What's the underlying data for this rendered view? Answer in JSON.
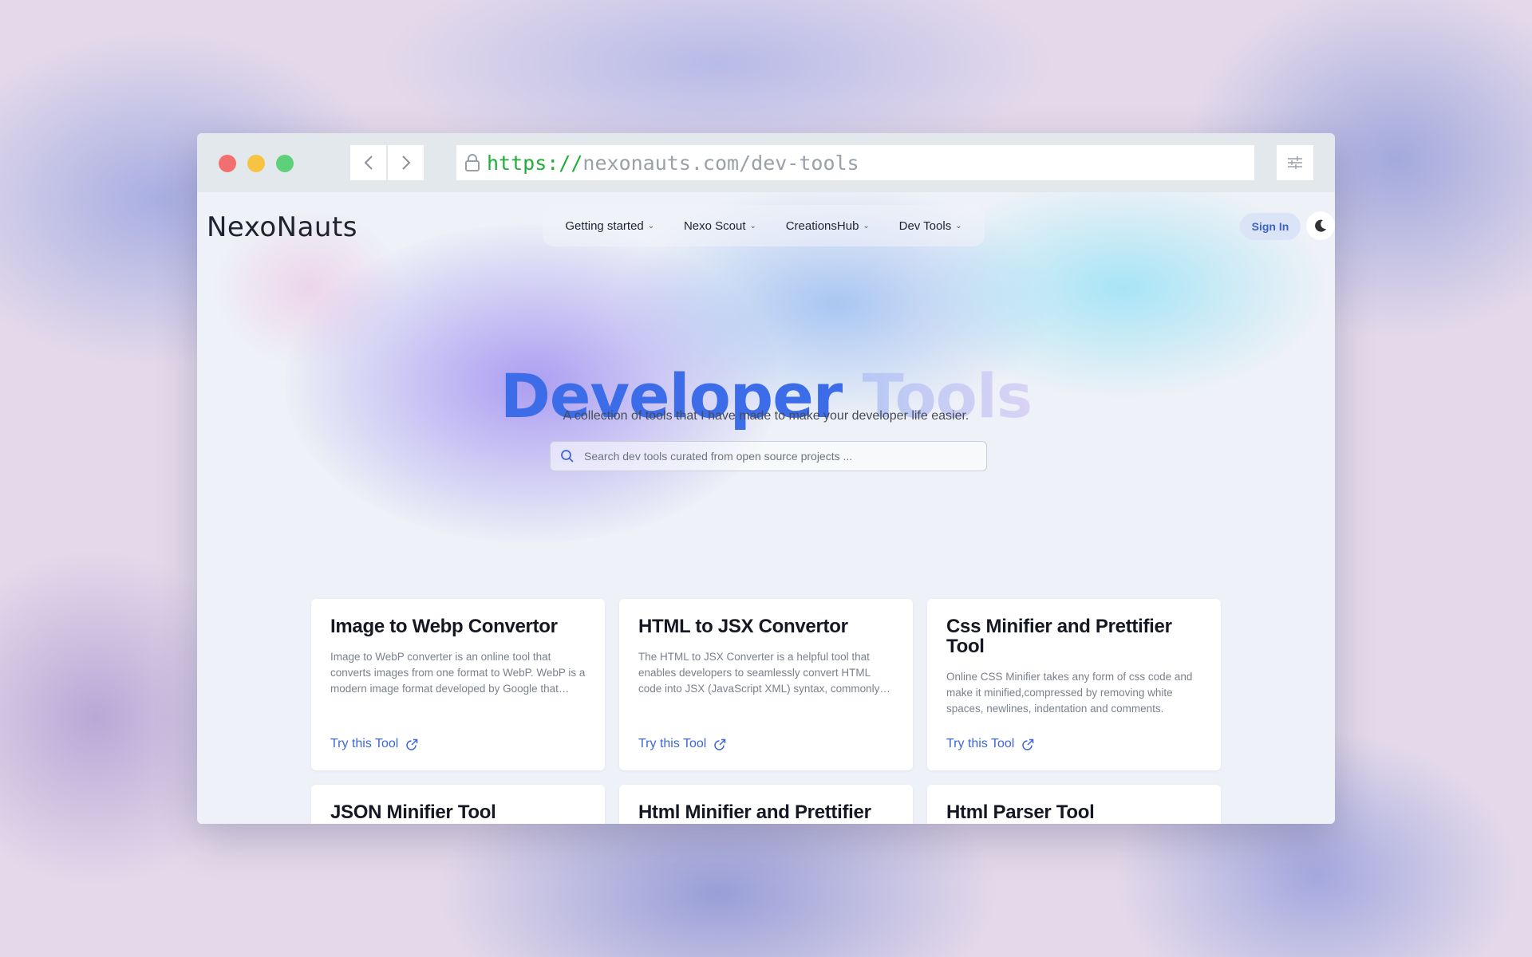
{
  "browser": {
    "url_protocol": "https://",
    "url_path": "nexonauts.com/dev-tools"
  },
  "site": {
    "logo": "NexoNauts",
    "nav": [
      {
        "label": "Getting started"
      },
      {
        "label": "Nexo Scout"
      },
      {
        "label": "CreationsHub"
      },
      {
        "label": "Dev Tools"
      }
    ],
    "signin_label": "Sign In"
  },
  "hero": {
    "title_word1": "Developer",
    "title_word2": "Tools",
    "subtitle": "A collection of tools that I have made to make your developer life easier.",
    "search_placeholder": "Search dev tools curated from open source projects ..."
  },
  "tools": [
    {
      "title": "Image to Webp Convertor",
      "description": "Image to WebP converter is an online tool that converts images from one format to WebP. WebP is a modern image format developed by Google that provides superior lossless and lossy compression.",
      "cta": "Try this Tool"
    },
    {
      "title": "HTML to JSX Convertor",
      "description": "The HTML to JSX Converter is a helpful tool that enables developers to seamlessly convert HTML code into JSX (JavaScript XML) syntax, commonly used in React applications.",
      "cta": "Try this Tool"
    },
    {
      "title": "Css Minifier and Prettifier Tool",
      "description": "Online CSS Minifier takes any form of css code and make it minified,compressed by removing white spaces, newlines, indentation and comments.",
      "cta": "Try this Tool"
    },
    {
      "title": "JSON Minifier Tool"
    },
    {
      "title": "Html Minifier and Prettifier"
    },
    {
      "title": "Html Parser Tool"
    }
  ],
  "colors": {
    "accent": "#3c6ce8",
    "link": "#3d66d6",
    "url_protocol": "#1fae3a"
  }
}
